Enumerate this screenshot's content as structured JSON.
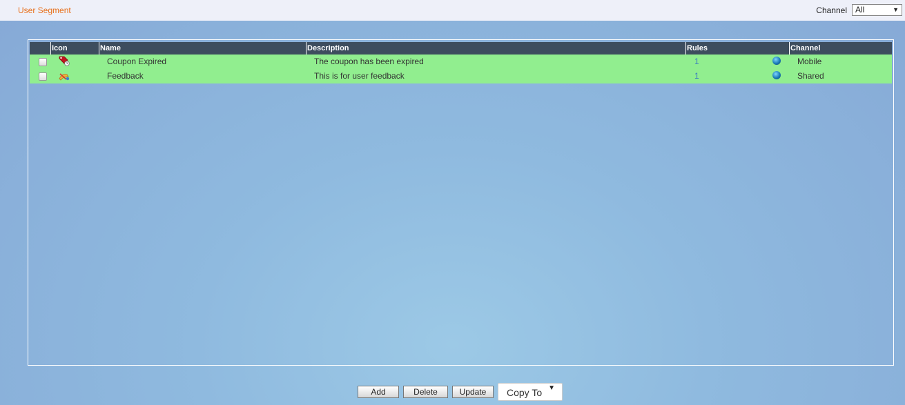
{
  "header": {
    "title": "User Segment",
    "channel_label": "Channel",
    "channel_selected": "All"
  },
  "grid": {
    "columns": [
      "Icon",
      "Name",
      "Description",
      "Rules",
      "Channel"
    ],
    "rows": [
      {
        "icon": "coupon-tag-icon",
        "name": "Coupon Expired",
        "description": "The coupon has been expired",
        "rules": "1",
        "channel": "Mobile"
      },
      {
        "icon": "feedback-pencil-icon",
        "name": "Feedback",
        "description": "This is for user feedback",
        "rules": "1",
        "channel": "Shared"
      }
    ]
  },
  "footer": {
    "add_label": "Add",
    "delete_label": "Delete",
    "update_label": "Update",
    "copy_to_label": "Copy To"
  },
  "colors": {
    "title": "#e8711d",
    "header_bg": "#3d4d5e",
    "row_bg": "#91ee8f"
  }
}
